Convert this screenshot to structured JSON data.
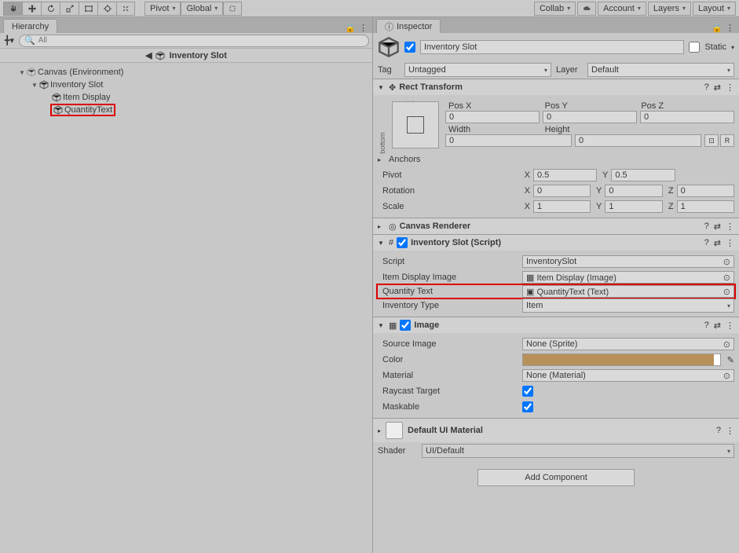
{
  "toolbar": {
    "pivot": "Pivot",
    "global": "Global",
    "collab": "Collab",
    "account": "Account",
    "layers": "Layers",
    "layout": "Layout"
  },
  "hierarchy": {
    "tab": "Hierarchy",
    "searchPlaceholder": "All",
    "breadcrumb": "Inventory Slot",
    "items": {
      "canvas": "Canvas (Environment)",
      "slot": "Inventory Slot",
      "itemDisplay": "Item Display",
      "quantityText": "QuantityText"
    }
  },
  "inspector": {
    "tab": "Inspector",
    "name": "Inventory Slot",
    "staticLabel": "Static",
    "tagLabel": "Tag",
    "tagValue": "Untagged",
    "layerLabel": "Layer",
    "layerValue": "Default",
    "rect": {
      "title": "Rect Transform",
      "left": "left",
      "bottom": "bottom",
      "posX": "Pos X",
      "posY": "Pos Y",
      "posZ": "Pos Z",
      "width": "Width",
      "height": "Height",
      "pxv": "0",
      "pyv": "0",
      "pzv": "0",
      "wv": "0",
      "hv": "0",
      "anchors": "Anchors",
      "pivot": "Pivot",
      "pivotX": "0.5",
      "pivotY": "0.5",
      "rotation": "Rotation",
      "rx": "0",
      "ry": "0",
      "rz": "0",
      "scale": "Scale",
      "sx": "1",
      "sy": "1",
      "sz": "1",
      "r": "R"
    },
    "canvasRenderer": "Canvas Renderer",
    "script": {
      "title": "Inventory Slot (Script)",
      "scriptLabel": "Script",
      "scriptValue": "InventorySlot",
      "imgLabel": "Item Display Image",
      "imgValue": "Item Display (Image)",
      "qtyLabel": "Quantity Text",
      "qtyValue": "QuantityText (Text)",
      "invTypeLabel": "Inventory Type",
      "invTypeValue": "Item"
    },
    "image": {
      "title": "Image",
      "srcLabel": "Source Image",
      "srcValue": "None (Sprite)",
      "colorLabel": "Color",
      "colorValue": "#B8905A",
      "matLabel": "Material",
      "matValue": "None (Material)",
      "raycastLabel": "Raycast Target",
      "maskableLabel": "Maskable"
    },
    "material": {
      "title": "Default UI Material",
      "shaderLabel": "Shader",
      "shaderValue": "UI/Default"
    },
    "addComponent": "Add Component",
    "axes": {
      "x": "X",
      "y": "Y",
      "z": "Z"
    }
  }
}
